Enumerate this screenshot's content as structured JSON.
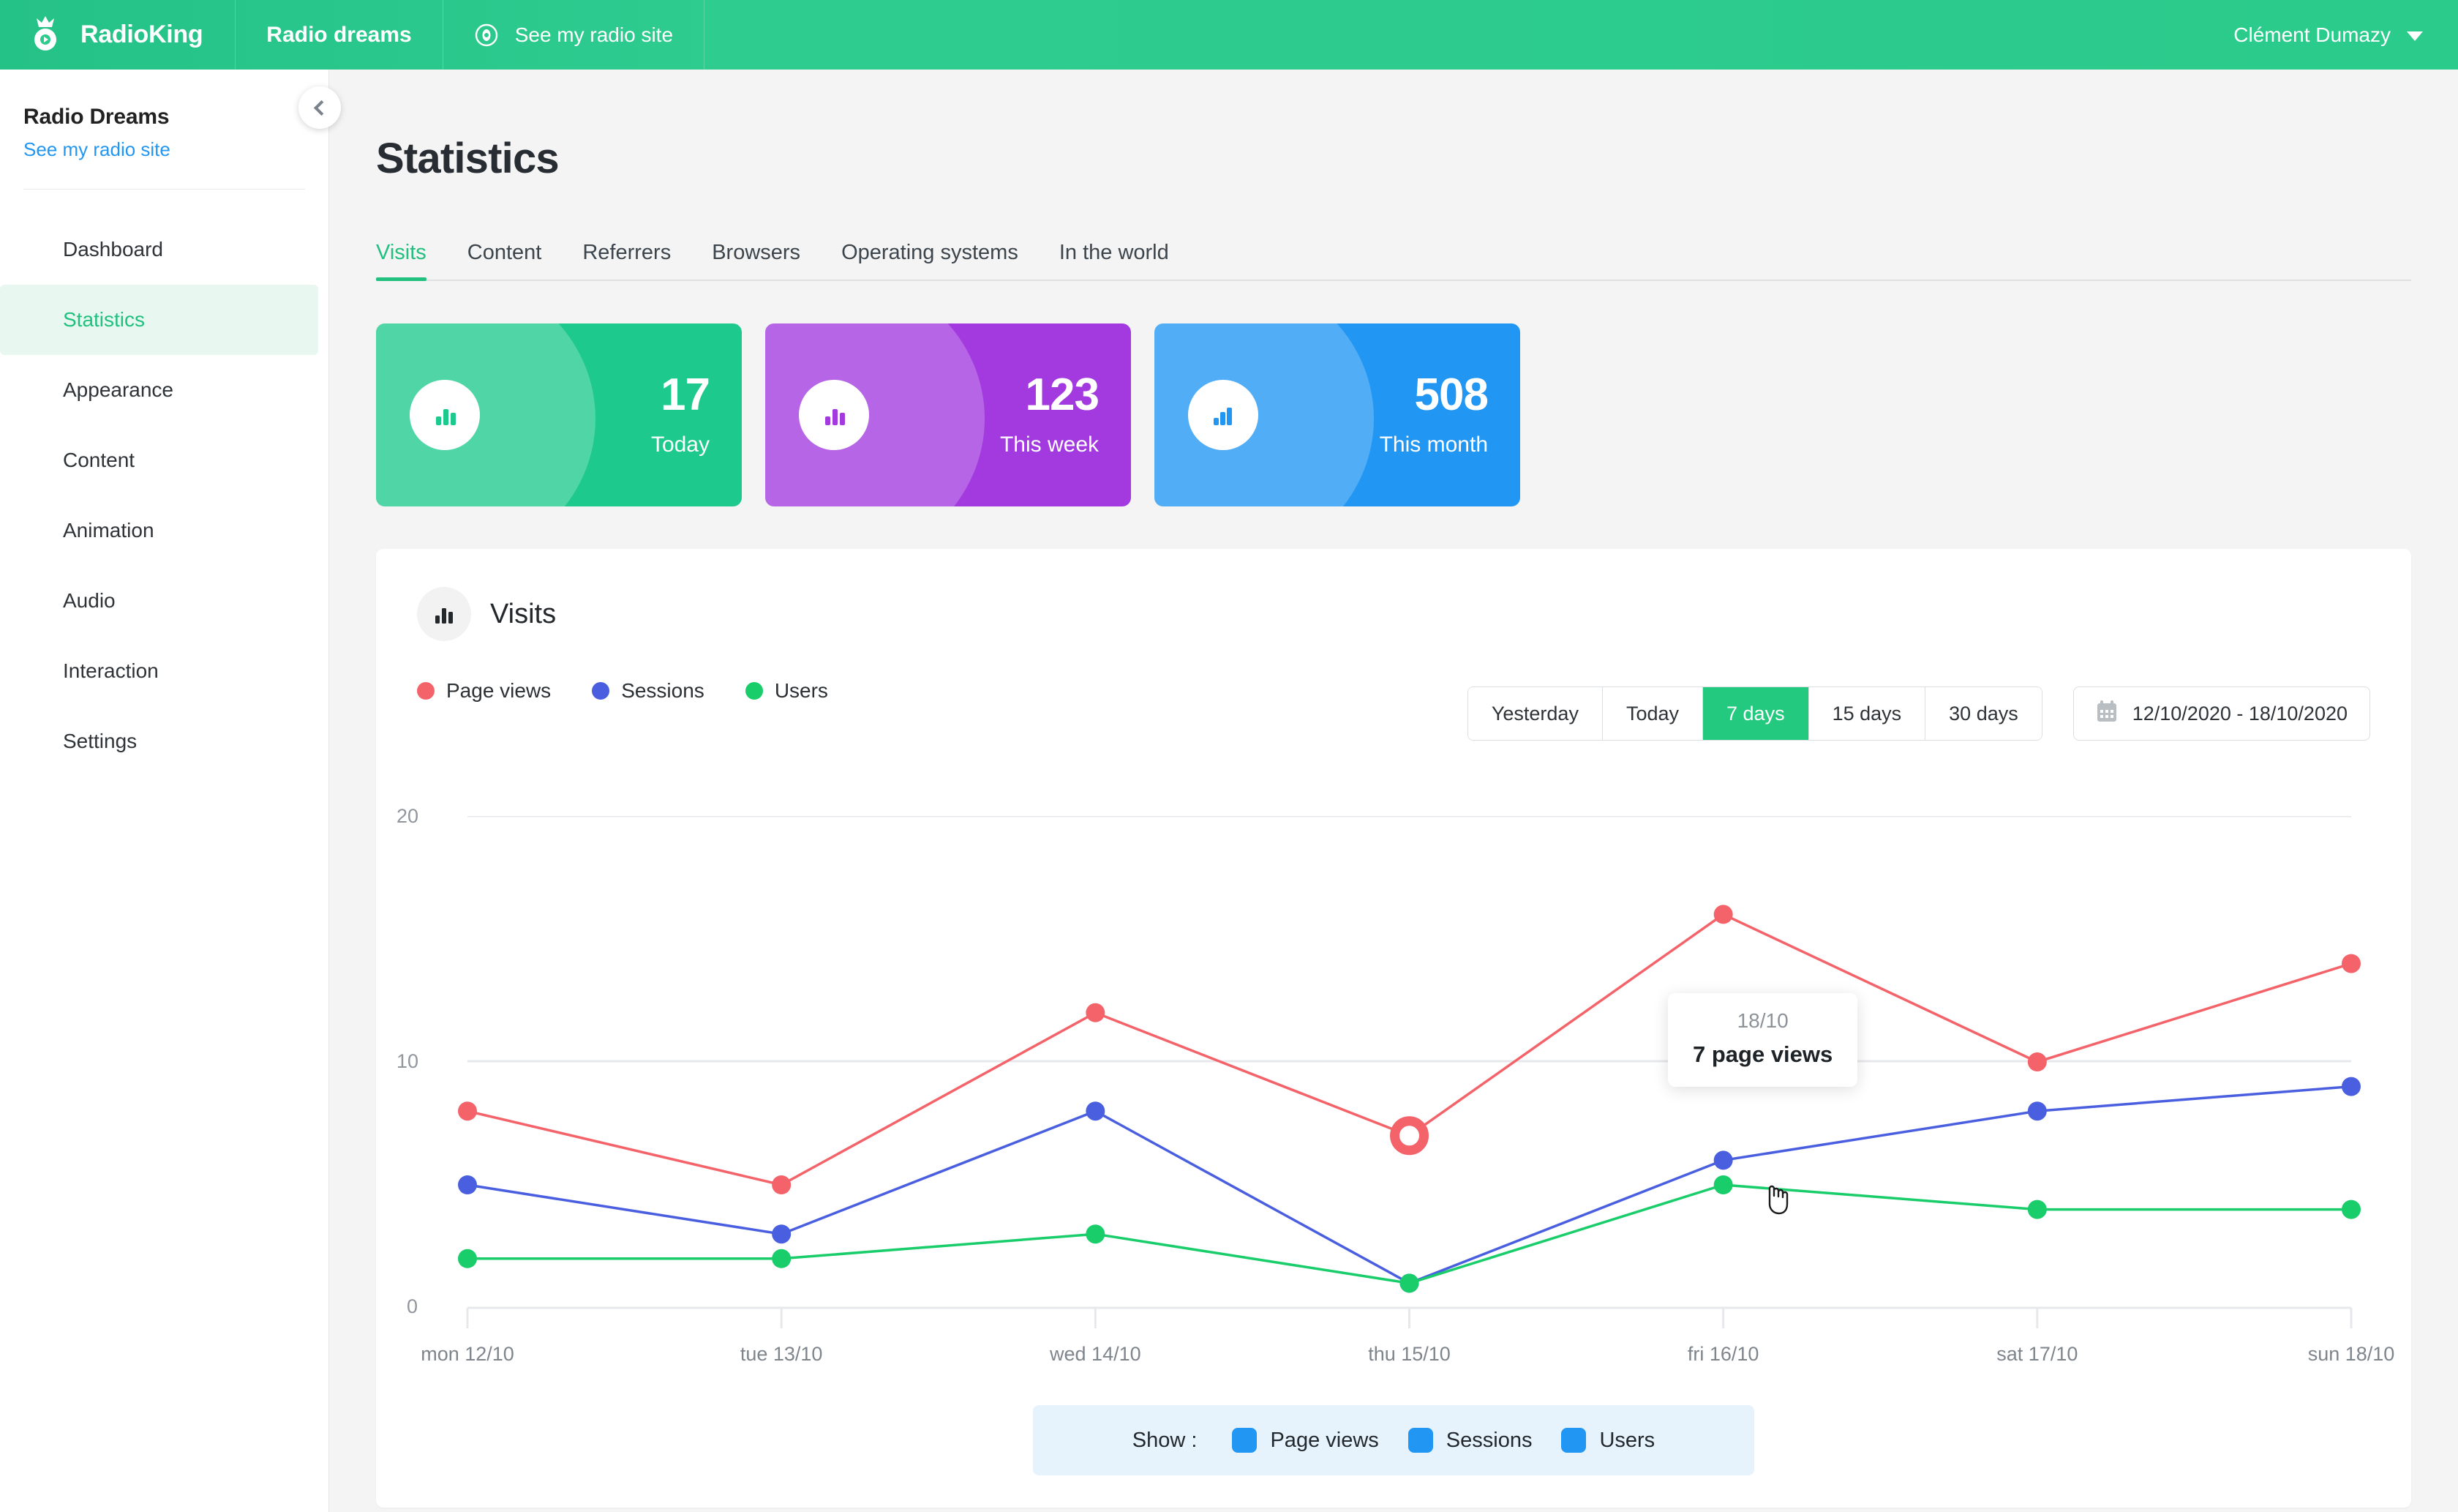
{
  "topbar": {
    "brand": "RadioKing",
    "radio_name": "Radio dreams",
    "see_site": "See my radio site",
    "user_name": "Clément Dumazy",
    "eye_icon": "eye-icon",
    "caret_icon": "chevron-down-icon"
  },
  "sidebar": {
    "title": "Radio Dreams",
    "link": "See my radio site",
    "collapse_icon": "chevron-left-icon",
    "items": [
      {
        "label": "Dashboard",
        "active": false
      },
      {
        "label": "Statistics",
        "active": true
      },
      {
        "label": "Appearance",
        "active": false
      },
      {
        "label": "Content",
        "active": false
      },
      {
        "label": "Animation",
        "active": false
      },
      {
        "label": "Audio",
        "active": false
      },
      {
        "label": "Interaction",
        "active": false
      },
      {
        "label": "Settings",
        "active": false
      }
    ]
  },
  "page": {
    "title": "Statistics",
    "tabs": [
      {
        "label": "Visits",
        "active": true
      },
      {
        "label": "Content",
        "active": false
      },
      {
        "label": "Referrers",
        "active": false
      },
      {
        "label": "Browsers",
        "active": false
      },
      {
        "label": "Operating systems",
        "active": false
      },
      {
        "label": "In the world",
        "active": false
      }
    ]
  },
  "stat_cards": [
    {
      "value": "17",
      "label": "Today",
      "color": "#1ec98d",
      "icon": "bar-chart-icon"
    },
    {
      "value": "123",
      "label": "This week",
      "color": "#a githubb",
      "icon": "bar-chart-icon"
    },
    {
      "value": "508",
      "label": "This month",
      "color": "#2196f3",
      "icon": "bar-chart-icon"
    }
  ],
  "panel": {
    "title": "Visits",
    "icon": "bar-chart-icon",
    "legend": [
      {
        "label": "Page views",
        "color": "#f4636a"
      },
      {
        "label": "Sessions",
        "color": "#4a5fe0"
      },
      {
        "label": "Users",
        "color": "#18cd6a"
      }
    ],
    "range_buttons": [
      {
        "label": "Yesterday",
        "active": false
      },
      {
        "label": "Today",
        "active": false
      },
      {
        "label": "7 days",
        "active": true
      },
      {
        "label": "15 days",
        "active": false
      },
      {
        "label": "30 days",
        "active": false
      }
    ],
    "date_range": "12/10/2020 - 18/10/2020",
    "calendar_icon": "calendar-icon",
    "tooltip": {
      "date": "18/10",
      "value": "7 page views"
    },
    "show_bar": {
      "label": "Show :",
      "items": [
        {
          "label": "Page views",
          "checked": true,
          "color": "#2196f3"
        },
        {
          "label": "Sessions",
          "checked": true,
          "color": "#2196f3"
        },
        {
          "label": "Users",
          "checked": true,
          "color": "#2196f3"
        }
      ]
    }
  },
  "chart_data": {
    "type": "line",
    "title": "Visits",
    "xlabel": "",
    "ylabel": "",
    "ylim": [
      0,
      20
    ],
    "yticks": [
      0,
      10,
      20
    ],
    "grid": true,
    "legend_position": "top-left",
    "categories": [
      "mon 12/10",
      "tue 13/10",
      "wed 14/10",
      "thu 15/10",
      "fri 16/10",
      "sat 17/10",
      "sun 18/10"
    ],
    "series": [
      {
        "name": "Page views",
        "color": "#f4636a",
        "values": [
          8,
          5,
          12,
          7,
          16,
          10,
          14
        ]
      },
      {
        "name": "Sessions",
        "color": "#4a5fe0",
        "values": [
          5,
          3,
          8,
          1,
          6,
          8,
          9
        ]
      },
      {
        "name": "Users",
        "color": "#18cd6a",
        "values": [
          2,
          2,
          3,
          1,
          5,
          4,
          4
        ]
      }
    ],
    "annotations": [
      {
        "x": "thu 15/10",
        "series": "Page views",
        "text": "18/10 — 7 page views",
        "highlighted": true
      }
    ]
  }
}
